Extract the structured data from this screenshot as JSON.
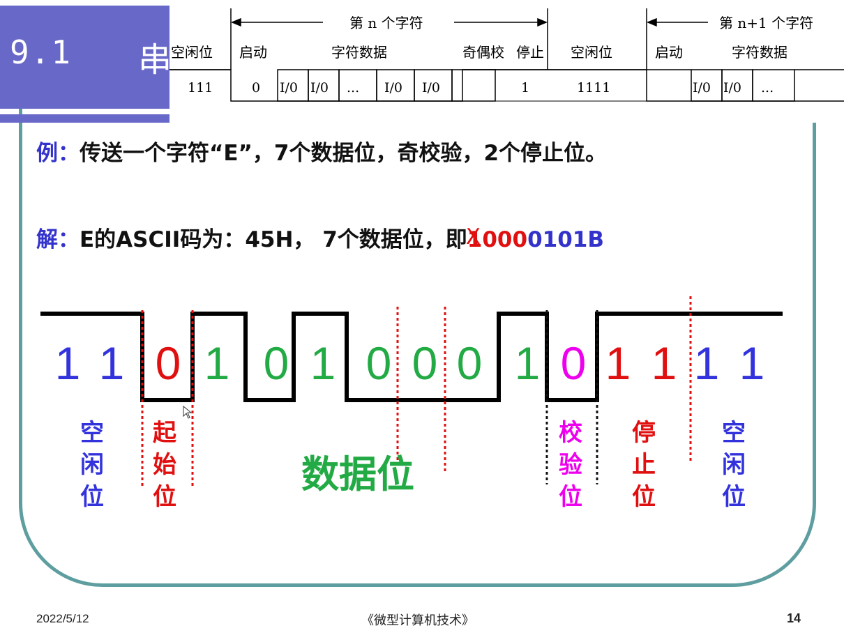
{
  "slide": {
    "title_num": "9.1",
    "title_char": "串",
    "example_label": "例：",
    "example_text": "传送一个字符“E”，7个数据位，奇校验，2个停止位。",
    "solution_label": "解：",
    "solution_text": "E的ASCII码为：45H， 7个数据位，即",
    "solution_bit_red": "1",
    "solution_x_mark": "X",
    "solution_bits_red": "000",
    "solution_bits_blue": "0101B"
  },
  "frame_format": {
    "header_n": "第 n 个字符",
    "header_n1": "第 n+1 个字符",
    "columns": [
      "空闲位",
      "启动",
      "字符数据",
      "奇偶校",
      "停止",
      "空闲位",
      "启动",
      "字符数据"
    ],
    "values": [
      "111",
      "0",
      "I/0",
      "I/0",
      "...",
      "I/0",
      "I/0",
      "1",
      "1111",
      "I/0",
      "I/0",
      "..."
    ]
  },
  "waveform": {
    "bits": [
      "1",
      "1",
      "0",
      "1",
      "0",
      "1",
      "0",
      "0",
      "0",
      "1",
      "0",
      "1",
      "1",
      "1",
      "1"
    ],
    "bit_colors": [
      "#3333dd",
      "#3333dd",
      "#e01010",
      "#22aa44",
      "#22aa44",
      "#22aa44",
      "#22aa44",
      "#22aa44",
      "#22aa44",
      "#22aa44",
      "#ee00ee",
      "#e01010",
      "#e01010",
      "#3333dd",
      "#3333dd"
    ],
    "labels": {
      "idle1": "空闲位",
      "start": "起始位",
      "data": "数据位",
      "parity": "校验位",
      "stop": "停止位",
      "idle2": "空闲位"
    },
    "label_colors": {
      "idle": "#3333dd",
      "start": "#e01010",
      "data": "#22aa44",
      "parity": "#ee00ee",
      "stop": "#e01010"
    }
  },
  "footer": {
    "date": "2022/5/12",
    "course": "《微型计算机技术》",
    "page": "14"
  }
}
